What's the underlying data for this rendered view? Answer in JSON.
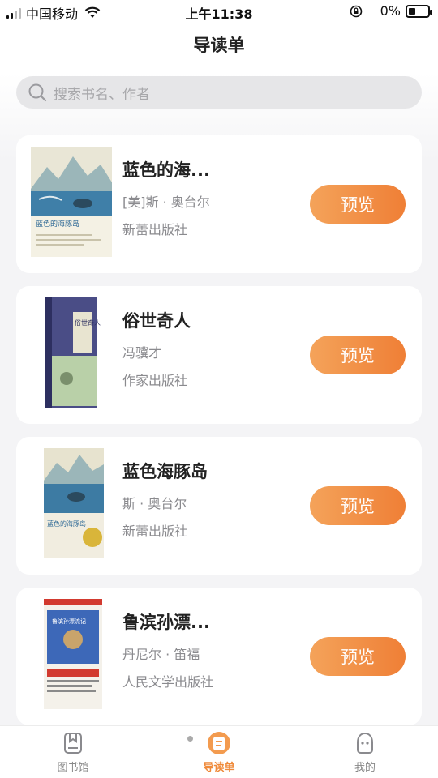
{
  "status_bar": {
    "carrier": "中国移动",
    "time": "上午11:38",
    "battery_text": "0%"
  },
  "header": {
    "title": "导读单"
  },
  "search": {
    "placeholder": "搜索书名、作者"
  },
  "books": [
    {
      "title": "蓝色的海...",
      "author": "[美]斯 · 奥台尔",
      "publisher": "新蕾出版社",
      "button": "预览",
      "cover_text": "蓝色的海豚岛",
      "cover_colors": [
        "#e9e6d6",
        "#3f7fa8",
        "#2f6a96"
      ]
    },
    {
      "title": "俗世奇人",
      "author": "冯骥才",
      "publisher": "作家出版社",
      "button": "预览",
      "cover_text": "俗世奇人",
      "cover_colors": [
        "#4a4d86",
        "#b9d0a8",
        "#2d2f60"
      ]
    },
    {
      "title": "蓝色海豚岛",
      "author": "斯 · 奥台尔",
      "publisher": "新蕾出版社",
      "button": "预览",
      "cover_text": "蓝色的海豚岛",
      "cover_colors": [
        "#e7e3cf",
        "#3d7ba3",
        "#d9b53a"
      ]
    },
    {
      "title": "鲁滨孙漂...",
      "author": "丹尼尔 · 笛福",
      "publisher": "人民文学出版社",
      "button": "预览",
      "cover_text": "鲁滨孙漂流记",
      "cover_colors": [
        "#3d68b8",
        "#c9a46b",
        "#d23a2f"
      ]
    }
  ],
  "tabs": [
    {
      "label": "图书馆",
      "icon": "book-icon",
      "active": false
    },
    {
      "label": "导读单",
      "icon": "list-icon",
      "active": true
    },
    {
      "label": "我的",
      "icon": "face-icon",
      "active": false
    }
  ],
  "colors": {
    "accent": "#ef7f36",
    "accent_light": "#f4a35a",
    "background": "#f4f4f6"
  }
}
